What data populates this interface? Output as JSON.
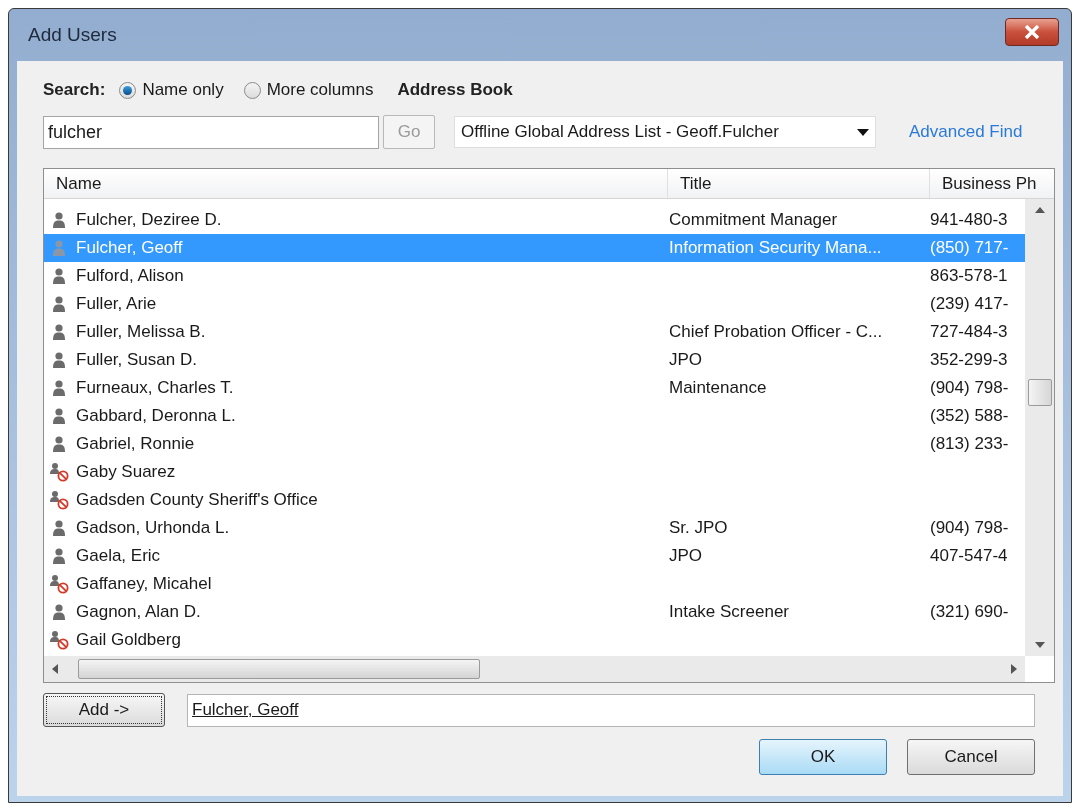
{
  "window": {
    "title": "Add Users"
  },
  "search": {
    "label": "Search:",
    "options": [
      {
        "label": "Name only",
        "selected": true
      },
      {
        "label": "More columns",
        "selected": false
      }
    ],
    "value": "fulcher",
    "go_button": {
      "label": "Go",
      "disabled": true
    }
  },
  "address_book": {
    "label": "Address Book",
    "value": "Offline Global Address List - Geoff.Fulcher"
  },
  "advanced_find": {
    "label": "Advanced Find"
  },
  "table": {
    "columns": [
      "Name",
      "Title",
      "Business Ph"
    ],
    "rows": [
      {
        "kind": "user",
        "name": "Fulcher, Deziree D.",
        "title": "Commitment Manager",
        "phone": "941-480-3",
        "selected": false
      },
      {
        "kind": "user",
        "name": "Fulcher, Geoff",
        "title": "Information Security Mana...",
        "phone": "(850) 717-",
        "selected": true
      },
      {
        "kind": "user",
        "name": "Fulford, Alison",
        "title": "",
        "phone": "863-578-1",
        "selected": false
      },
      {
        "kind": "user",
        "name": "Fuller, Arie",
        "title": "",
        "phone": "(239) 417-",
        "selected": false
      },
      {
        "kind": "user",
        "name": "Fuller, Melissa B.",
        "title": "Chief Probation Officer - C...",
        "phone": "727-484-3",
        "selected": false
      },
      {
        "kind": "user",
        "name": "Fuller, Susan D.",
        "title": "JPO",
        "phone": "352-299-3",
        "selected": false
      },
      {
        "kind": "user",
        "name": "Furneaux, Charles T.",
        "title": "Maintenance",
        "phone": "(904) 798-",
        "selected": false
      },
      {
        "kind": "user",
        "name": "Gabbard, Deronna L.",
        "title": "",
        "phone": "(352) 588-",
        "selected": false
      },
      {
        "kind": "user",
        "name": "Gabriel, Ronnie",
        "title": "",
        "phone": "(813) 233-",
        "selected": false
      },
      {
        "kind": "blocked",
        "name": "Gaby Suarez",
        "title": "",
        "phone": "",
        "selected": false
      },
      {
        "kind": "blocked",
        "name": "Gadsden County Sheriff's Office",
        "title": "",
        "phone": "",
        "selected": false
      },
      {
        "kind": "user",
        "name": "Gadson, Urhonda L.",
        "title": "Sr. JPO",
        "phone": "(904) 798-",
        "selected": false
      },
      {
        "kind": "user",
        "name": "Gaela, Eric",
        "title": "JPO",
        "phone": "407-547-4",
        "selected": false
      },
      {
        "kind": "blocked",
        "name": "Gaffaney, Micahel",
        "title": "",
        "phone": "",
        "selected": false
      },
      {
        "kind": "user",
        "name": "Gagnon, Alan D.",
        "title": "Intake Screener",
        "phone": "(321) 690-",
        "selected": false
      },
      {
        "kind": "blocked",
        "name": "Gail Goldberg",
        "title": "",
        "phone": "",
        "selected": false
      }
    ]
  },
  "add_button": {
    "label": "Add ->"
  },
  "recipients": {
    "value": "Fulcher, Geoff"
  },
  "buttons": [
    {
      "label": "OK",
      "kind": "default"
    },
    {
      "label": "Cancel",
      "kind": "normal"
    }
  ]
}
